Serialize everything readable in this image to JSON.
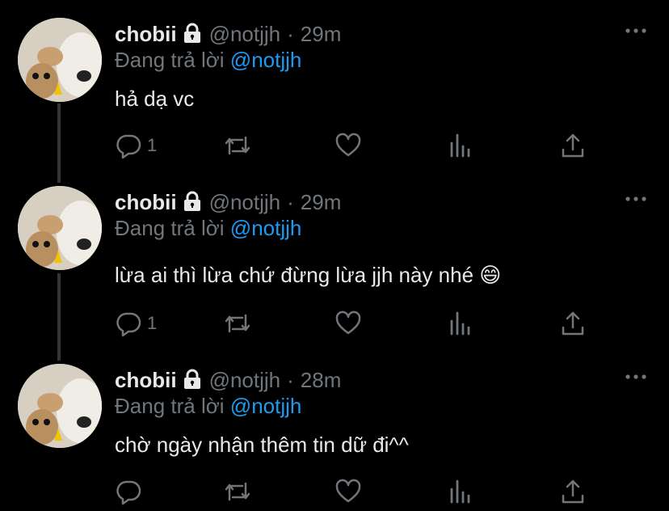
{
  "colors": {
    "background": "#000000",
    "primary_text": "#e7e9ea",
    "secondary_text": "#71767b",
    "link": "#1d9bf0",
    "thread_line": "#333639"
  },
  "tweets": [
    {
      "name": "chobii",
      "handle": "@notjjh",
      "sep": "·",
      "time": "29m",
      "reply_prefix": "Đang trả lời",
      "reply_to": "@notjjh",
      "text": "hả dạ vc",
      "reply_count": "1"
    },
    {
      "name": "chobii",
      "handle": "@notjjh",
      "sep": "·",
      "time": "29m",
      "reply_prefix": "Đang trả lời",
      "reply_to": "@notjjh",
      "text": "lừa ai thì lừa chứ đừng lừa jjh này nhé 😄",
      "reply_count": "1"
    },
    {
      "name": "chobii",
      "handle": "@notjjh",
      "sep": "·",
      "time": "28m",
      "reply_prefix": "Đang trả lời",
      "reply_to": "@notjjh",
      "text": "chờ ngày nhận thêm tin dữ đi^^",
      "reply_count": ""
    }
  ],
  "icons": [
    "lock-icon",
    "more-icon",
    "reply-icon",
    "retweet-icon",
    "like-icon",
    "views-icon",
    "share-icon"
  ]
}
